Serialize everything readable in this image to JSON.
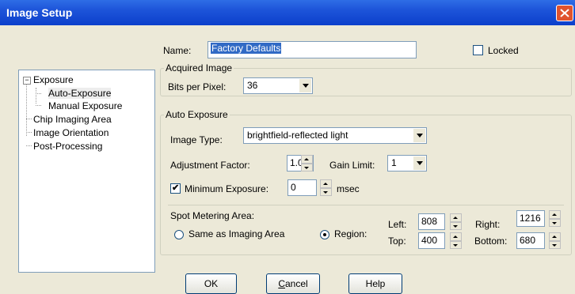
{
  "window": {
    "title": "Image Setup"
  },
  "tree": {
    "items": [
      {
        "label": "Exposure",
        "expander": "−"
      },
      {
        "label": "Auto-Exposure"
      },
      {
        "label": "Manual Exposure"
      },
      {
        "label": "Chip Imaging Area"
      },
      {
        "label": "Image Orientation"
      },
      {
        "label": "Post-Processing"
      }
    ]
  },
  "name": {
    "label": "Name:",
    "value": "Factory Defaults"
  },
  "locked": {
    "label": "Locked",
    "checked": false
  },
  "acquired": {
    "title": "Acquired Image",
    "bits_label": "Bits per Pixel:",
    "bits_value": "36"
  },
  "auto_exposure": {
    "title": "Auto Exposure",
    "image_type_label": "Image Type:",
    "image_type_value": "brightfield-reflected light",
    "adj_label": "Adjustment Factor:",
    "adj_value": "1.00",
    "gain_label": "Gain Limit:",
    "gain_value": "1",
    "min_exp_label": "Minimum Exposure:",
    "min_exp_checked": true,
    "min_exp_value": "0",
    "min_exp_unit": "msec",
    "spot_title": "Spot Metering Area:",
    "same_label": "Same as Imaging Area",
    "region_label": "Region:",
    "left_label": "Left:",
    "left_value": "808",
    "top_label": "Top:",
    "top_value": "400",
    "right_label": "Right:",
    "right_value": "1216",
    "bottom_label": "Bottom:",
    "bottom_value": "680",
    "selected_option": "Region"
  },
  "buttons": {
    "ok": "OK",
    "cancel": "Cancel",
    "help": "Help"
  },
  "colors": {
    "titlebar": "#0B3FCB",
    "close": "#E0532E",
    "selection": "#316AC5",
    "dialog_bg": "#ECE9D8"
  }
}
